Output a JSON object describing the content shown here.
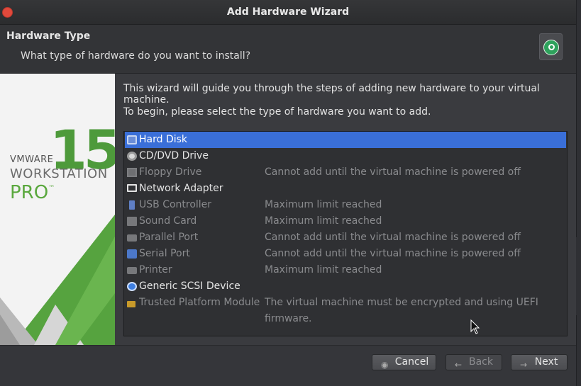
{
  "window": {
    "title": "Add Hardware Wizard"
  },
  "header": {
    "title": "Hardware Type",
    "subtitle": "What type of hardware do you want to install?",
    "icon": "vmware-hardware-icon"
  },
  "sidebar": {
    "brand_small": "VMWARE",
    "brand_product": "WORKSTATION",
    "brand_edition": "PRO",
    "trademark": "™",
    "version": "15",
    "accent_color": "#4e9a3b"
  },
  "main": {
    "intro_line1": "This wizard will guide you through the steps of adding new hardware to your virtual machine.",
    "intro_line2": "To begin, please select the type of hardware you want to add."
  },
  "hardware": [
    {
      "name": "Hard Disk",
      "desc": "",
      "enabled": true,
      "selected": true,
      "icon": "hard-disk-icon"
    },
    {
      "name": "CD/DVD Drive",
      "desc": "",
      "enabled": true,
      "selected": false,
      "icon": "cd-dvd-icon"
    },
    {
      "name": "Floppy Drive",
      "desc": "Cannot add until the virtual machine is powered off",
      "enabled": false,
      "selected": false,
      "icon": "floppy-icon"
    },
    {
      "name": "Network Adapter",
      "desc": "",
      "enabled": true,
      "selected": false,
      "icon": "network-adapter-icon"
    },
    {
      "name": "USB Controller",
      "desc": "Maximum limit reached",
      "enabled": false,
      "selected": false,
      "icon": "usb-icon"
    },
    {
      "name": "Sound Card",
      "desc": "Maximum limit reached",
      "enabled": false,
      "selected": false,
      "icon": "sound-card-icon"
    },
    {
      "name": "Parallel Port",
      "desc": "Cannot add until the virtual machine is powered off",
      "enabled": false,
      "selected": false,
      "icon": "parallel-port-icon"
    },
    {
      "name": "Serial Port",
      "desc": "Cannot add until the virtual machine is powered off",
      "enabled": false,
      "selected": false,
      "icon": "serial-port-icon"
    },
    {
      "name": "Printer",
      "desc": "Maximum limit reached",
      "enabled": false,
      "selected": false,
      "icon": "printer-icon"
    },
    {
      "name": "Generic SCSI Device",
      "desc": "",
      "enabled": true,
      "selected": false,
      "icon": "scsi-icon"
    },
    {
      "name": "Trusted Platform Module",
      "desc": "The virtual machine must be encrypted and using UEFI firmware.",
      "enabled": false,
      "selected": false,
      "icon": "tpm-icon"
    }
  ],
  "buttons": {
    "cancel": "Cancel",
    "back": "Back",
    "next": "Next"
  },
  "colors": {
    "selection": "#3a6fd8",
    "disabled_text": "#8a8b8e"
  }
}
